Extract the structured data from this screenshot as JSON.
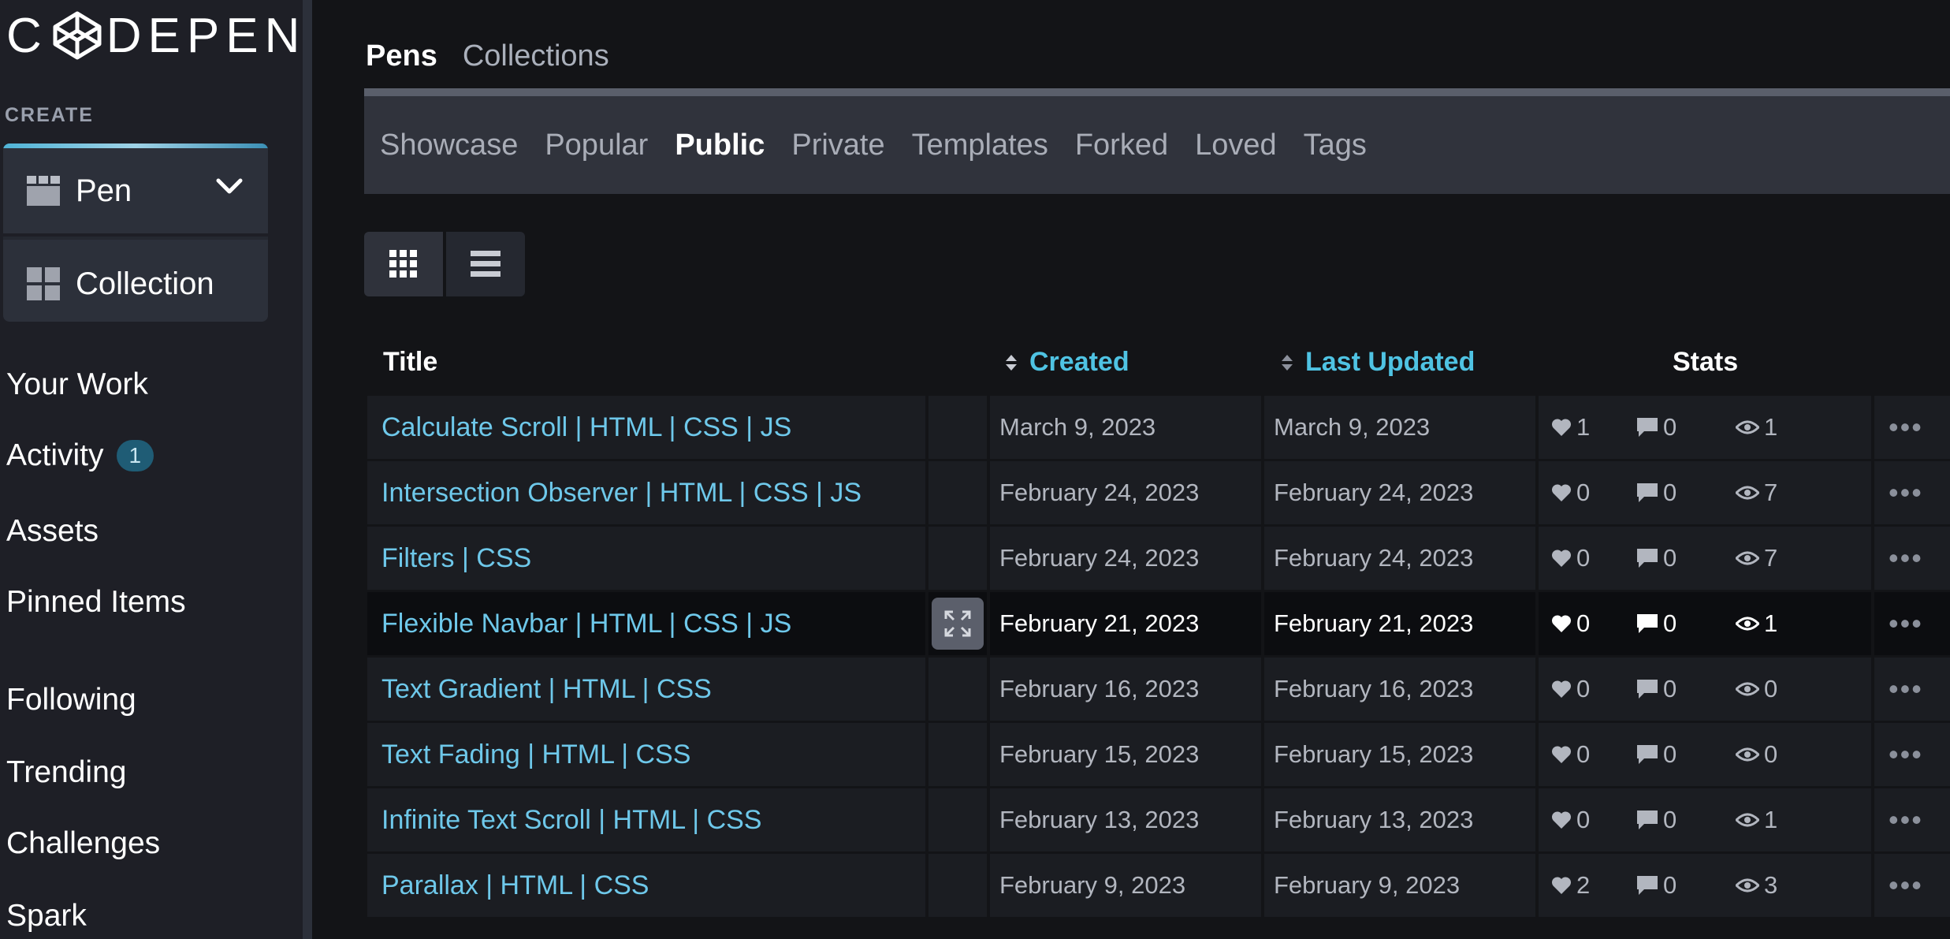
{
  "brand": {
    "logo_text_1": "C",
    "logo_text_2": "DEPEN"
  },
  "sidebar": {
    "create_label": "CREATE",
    "create_buttons": [
      {
        "label": "Pen",
        "icon": "pen-grid-icon"
      },
      {
        "label": "Collection",
        "icon": "collection-grid-icon"
      }
    ],
    "nav": [
      {
        "label": "Your Work"
      },
      {
        "label": "Activity",
        "badge": "1"
      },
      {
        "label": "Assets"
      },
      {
        "label": "Pinned Items"
      },
      {
        "label": "Following"
      },
      {
        "label": "Trending"
      },
      {
        "label": "Challenges"
      },
      {
        "label": "Spark"
      }
    ]
  },
  "main": {
    "top_tabs": [
      {
        "label": "Pens",
        "active": true
      },
      {
        "label": "Collections",
        "active": false
      }
    ],
    "sub_tabs": [
      {
        "label": "Showcase"
      },
      {
        "label": "Popular"
      },
      {
        "label": "Public",
        "active": true
      },
      {
        "label": "Private"
      },
      {
        "label": "Templates"
      },
      {
        "label": "Forked"
      },
      {
        "label": "Loved"
      },
      {
        "label": "Tags"
      }
    ],
    "view_modes": [
      "grid-view-icon",
      "list-view-icon"
    ],
    "columns": {
      "title": "Title",
      "created": "Created",
      "updated": "Last Updated",
      "stats": "Stats"
    },
    "rows": [
      {
        "title": "Calculate Scroll | HTML | CSS | JS",
        "created": "March 9, 2023",
        "updated": "March 9, 2023",
        "likes": "1",
        "comments": "0",
        "views": "1"
      },
      {
        "title": "Intersection Observer | HTML | CSS | JS",
        "created": "February 24, 2023",
        "updated": "February 24, 2023",
        "likes": "0",
        "comments": "0",
        "views": "7"
      },
      {
        "title": "Filters | CSS",
        "created": "February 24, 2023",
        "updated": "February 24, 2023",
        "likes": "0",
        "comments": "0",
        "views": "7"
      },
      {
        "title": "Flexible Navbar | HTML | CSS | JS",
        "created": "February 21, 2023",
        "updated": "February 21, 2023",
        "likes": "0",
        "comments": "0",
        "views": "1"
      },
      {
        "title": "Text Gradient | HTML | CSS",
        "created": "February 16, 2023",
        "updated": "February 16, 2023",
        "likes": "0",
        "comments": "0",
        "views": "0"
      },
      {
        "title": "Text Fading | HTML | CSS",
        "created": "February 15, 2023",
        "updated": "February 15, 2023",
        "likes": "0",
        "comments": "0",
        "views": "0"
      },
      {
        "title": "Infinite Text Scroll | HTML | CSS",
        "created": "February 13, 2023",
        "updated": "February 13, 2023",
        "likes": "0",
        "comments": "0",
        "views": "1"
      },
      {
        "title": "Parallax | HTML | CSS",
        "created": "February 9, 2023",
        "updated": "February 9, 2023",
        "likes": "2",
        "comments": "0",
        "views": "3"
      }
    ],
    "more_label": "•••"
  },
  "colors": {
    "accent": "#4fc3e3",
    "link": "#6ec8ea",
    "sidebar_bg": "#1e1f26",
    "page_bg": "#131417"
  }
}
